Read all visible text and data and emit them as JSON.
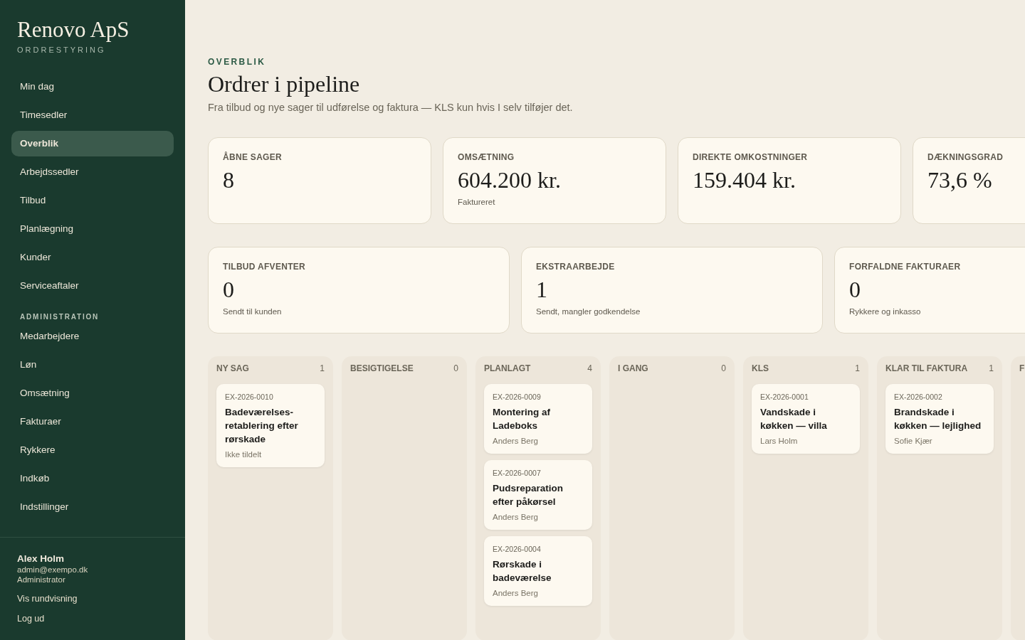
{
  "brand": {
    "name": "Renovo ApS",
    "subtitle": "ORDRESTYRING"
  },
  "nav": [
    {
      "label": "Min dag",
      "selected": false
    },
    {
      "label": "Timesedler",
      "selected": false
    },
    {
      "label": "Overblik",
      "selected": true
    },
    {
      "label": "Arbejdssedler",
      "selected": false
    },
    {
      "label": "Tilbud",
      "selected": false
    },
    {
      "label": "Planlægning",
      "selected": false
    },
    {
      "label": "Kunder",
      "selected": false
    },
    {
      "label": "Serviceaftaler",
      "selected": false
    }
  ],
  "admin_section": {
    "heading": "ADMINISTRATION",
    "items": [
      {
        "label": "Medarbejdere",
        "selected": false
      },
      {
        "label": "Løn",
        "selected": false
      },
      {
        "label": "Omsætning",
        "selected": false
      },
      {
        "label": "Fakturaer",
        "selected": false
      },
      {
        "label": "Rykkere",
        "selected": false
      },
      {
        "label": "Indkøb",
        "selected": false
      },
      {
        "label": "Indstillinger",
        "selected": false
      }
    ]
  },
  "user": {
    "name": "Alex Holm",
    "email": "admin@exempo.dk",
    "role": "Administrator",
    "links": [
      "Vis rundvisning",
      "Log ud"
    ]
  },
  "header": {
    "eyebrow": "OVERBLIK",
    "title": "Ordrer i pipeline",
    "subtitle": "Fra tilbud og nye sager til udførelse og faktura — KLS kun hvis I selv tilføjer det."
  },
  "kpis": [
    {
      "label": "ÅBNE SAGER",
      "value": "8"
    },
    {
      "label": "OMSÆTNING",
      "value": "604.200 kr.",
      "note": "Faktureret"
    },
    {
      "label": "DIREKTE OMKOSTNINGER",
      "value": "159.404 kr."
    },
    {
      "label": "DÆKNINGSGRAD",
      "value": "73,6 %"
    }
  ],
  "kpis_secondary": [
    {
      "label": "TILBUD AFVENTER",
      "value": "0",
      "note": "Sendt til kunden"
    },
    {
      "label": "EKSTRAARBEJDE",
      "value": "1",
      "note": "Sendt, mangler godkendelse"
    },
    {
      "label": "FORFALDNE FAKTURAER",
      "value": "0",
      "note": "Rykkere og inkasso"
    }
  ],
  "columns": [
    {
      "title": "NY SAG",
      "count": "1",
      "cards": [
        {
          "number": "EX-2026-0010",
          "title": "Badeværelses-retablering efter rørskade",
          "assignee": "Ikke tildelt"
        }
      ]
    },
    {
      "title": "BESIGTIGELSE",
      "count": "0"
    },
    {
      "title": "PLANLAGT",
      "count": "4",
      "cards": [
        {
          "number": "EX-2026-0009",
          "title": "Montering af Ladeboks",
          "assignee": "Anders Berg"
        },
        {
          "number": "EX-2026-0007",
          "title": "Pudsreparation efter påkørsel",
          "assignee": "Anders Berg"
        },
        {
          "number": "EX-2026-0004",
          "title": "Rørskade i badeværelse",
          "assignee": "Anders Berg"
        }
      ]
    },
    {
      "title": "I GANG",
      "count": "0"
    },
    {
      "title": "KLS",
      "count": "1",
      "cards": [
        {
          "number": "EX-2026-0001",
          "title": "Vandskade i køkken — villa",
          "assignee": "Lars Holm"
        }
      ]
    },
    {
      "title": "KLAR TIL FAKTURA",
      "count": "1",
      "cards": [
        {
          "number": "EX-2026-0002",
          "title": "Brandskade i køkken — lejlighed",
          "assignee": "Sofie Kjær"
        }
      ]
    },
    {
      "title": "F"
    }
  ]
}
